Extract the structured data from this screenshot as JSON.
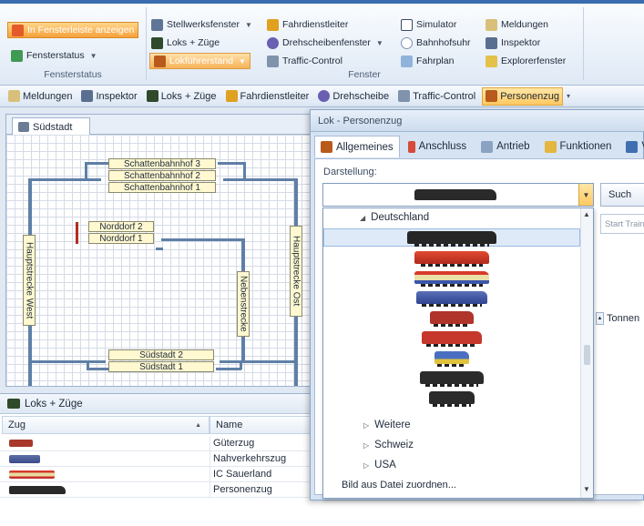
{
  "ribbon": {
    "btn_fensterleiste": "In Fensterleiste anzeigen",
    "btn_fensterstatus": "Fensterstatus",
    "group_fensterstatus": "Fensterstatus",
    "btn_stellwerk": "Stellwerksfenster",
    "btn_loks": "Loks + Züge",
    "btn_lokfuehrerstand": "Lokführerstand",
    "btn_fahrdienstleiter": "Fahrdienstleiter",
    "btn_drehscheibe": "Drehscheibenfenster",
    "btn_traffic": "Traffic-Control",
    "btn_simulator": "Simulator",
    "btn_bahnhofsuhr": "Bahnhofsuhr",
    "btn_fahrplan": "Fahrplan",
    "btn_meldungen": "Meldungen",
    "btn_inspektor": "Inspektor",
    "btn_explorer": "Explorerfenster",
    "group_fenster": "Fenster"
  },
  "quickbar": [
    "Meldungen",
    "Inspektor",
    "Loks + Züge",
    "Fahrdienstleiter",
    "Drehscheibe",
    "Traffic-Control",
    "Personenzug"
  ],
  "layout_tab": "Südstadt",
  "stations": {
    "sb3": "Schattenbahnhof 3",
    "sb2": "Schattenbahnhof 2",
    "sb1": "Schattenbahnhof 1",
    "nd2": "Norddorf 2",
    "nd1": "Norddorf 1",
    "hw": "Hauptstrecke West",
    "ho": "Hauptstrecke Ost",
    "ns": "Nebenstrecke",
    "ss2": "Südstadt 2",
    "ss1": "Südstadt 1"
  },
  "lokpane": {
    "title": "Loks + Züge",
    "col_zug": "Zug",
    "col_name": "Name",
    "rows": [
      "Güterzug",
      "Nahverkehrszug",
      "IC Sauerland",
      "Personenzug"
    ]
  },
  "dialog": {
    "title": "Lok - Personenzug",
    "tabs": [
      "Allgemeines",
      "Anschluss",
      "Antrieb",
      "Funktionen",
      "Ve"
    ],
    "darstellung": "Darstellung:",
    "search_btn": "Such",
    "start_placeholder": "Start Train",
    "tonnen": "Tonnen",
    "dropdown": {
      "group_de": "Deutschland",
      "group_weitere": "Weitere",
      "group_schweiz": "Schweiz",
      "group_usa": "USA",
      "footer": "Bild aus Datei zuordnen..."
    }
  },
  "colors": {
    "accent_orange": "#f7a13b",
    "track": "#5f7fa6",
    "platform": "#fff8d0"
  }
}
